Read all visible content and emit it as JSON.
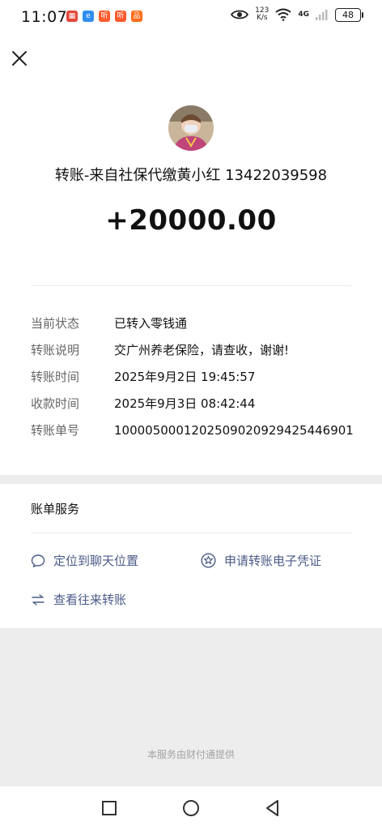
{
  "status_bar": {
    "time": "11:07",
    "notif_icons": [
      {
        "name": "app-icon-1",
        "glyph": "▦",
        "color": "#e4473c"
      },
      {
        "name": "app-icon-2",
        "glyph": "e",
        "color": "#2f8ff0"
      },
      {
        "name": "app-icon-3",
        "glyph": "听",
        "color": "#ff5a2c"
      },
      {
        "name": "app-icon-4",
        "glyph": "听",
        "color": "#ff5a2c"
      },
      {
        "name": "app-icon-5",
        "glyph": "品",
        "color": "#ff6c1a"
      }
    ],
    "speed_value": "123",
    "speed_unit": "K/s",
    "network": "4G",
    "battery": "48"
  },
  "transfer": {
    "title": "转账-来自社保代缴黄小红 13422039598",
    "amount": "+20000.00"
  },
  "details": [
    {
      "label": "当前状态",
      "value": "已转入零钱通"
    },
    {
      "label": "转账说明",
      "value": "交广州养老保险，请查收，谢谢!"
    },
    {
      "label": "转账时间",
      "value": "2025年9月2日 19:45:57"
    },
    {
      "label": "收款时间",
      "value": "2025年9月3日 08:42:44"
    },
    {
      "label": "转账单号",
      "value": "1000050001202509020929425446901"
    }
  ],
  "services": {
    "title": "账单服务",
    "locate_chat": "定位到聊天位置",
    "apply_voucher": "申请转账电子凭证",
    "view_history": "查看往来转账"
  },
  "footer": "本服务由财付通提供"
}
